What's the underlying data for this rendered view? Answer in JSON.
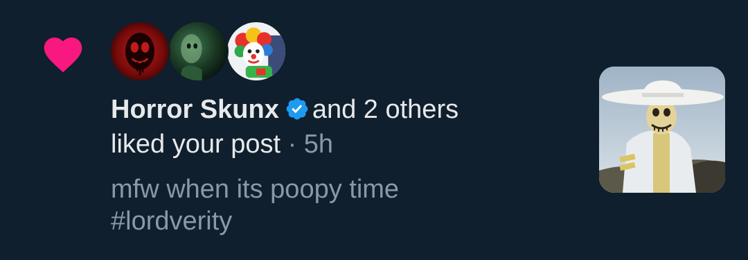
{
  "notification": {
    "type_icon": "heart-icon",
    "accent_color": "#f91880",
    "avatars": [
      {
        "icon": "red-skull-avatar"
      },
      {
        "icon": "green-ghost-avatar"
      },
      {
        "icon": "clown-avatar"
      }
    ],
    "user_name": "Horror Skunx",
    "verified": true,
    "verified_color": "#1d9bf0",
    "others_text": "and 2 others",
    "action_text": "liked your post",
    "separator": "·",
    "time": "5h",
    "post_preview": [
      "mfw when its poopy time",
      "#lordverity"
    ],
    "thumbnail": "white-hat-skeleton-thumbnail"
  }
}
